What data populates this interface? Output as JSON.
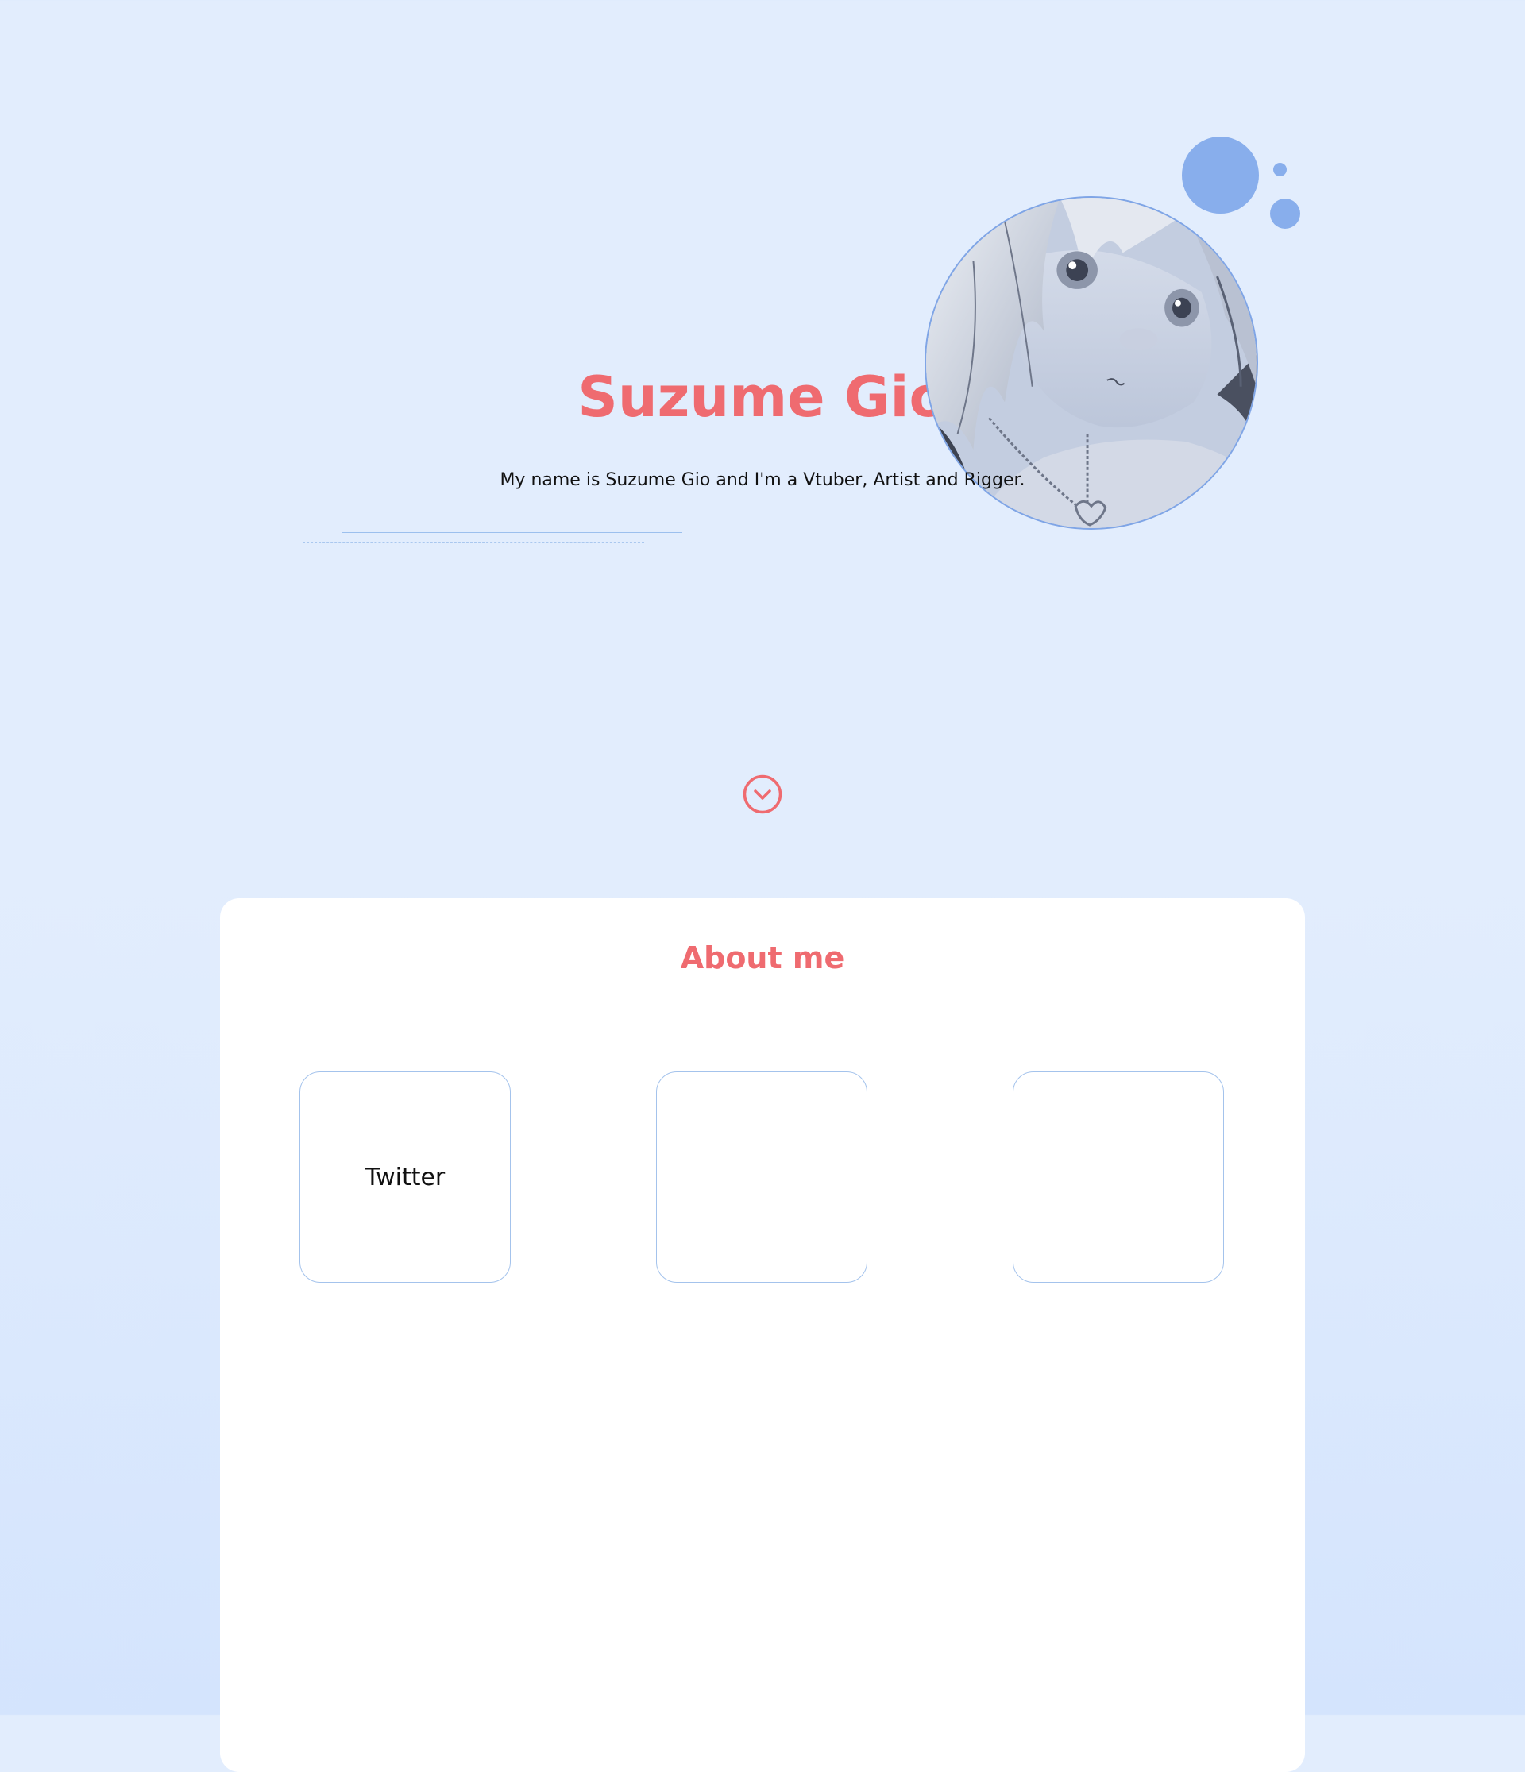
{
  "hero": {
    "title": "Suzume Gio",
    "subtitle": "My name is Suzume Gio and I'm a Vtuber, Artist and Rigger."
  },
  "about": {
    "title": "About me",
    "links": [
      {
        "label": "Twitter"
      },
      {
        "label": ""
      },
      {
        "label": ""
      }
    ]
  },
  "colors": {
    "accent": "#ef6b70",
    "bubble": "#88aeec",
    "outline": "#a4c3ec",
    "background_top": "#e2edfd",
    "background_bottom": "#d4e4fd",
    "card": "#ffffff"
  },
  "icons": {
    "scroll_down": "chevron-down-circle-icon"
  }
}
